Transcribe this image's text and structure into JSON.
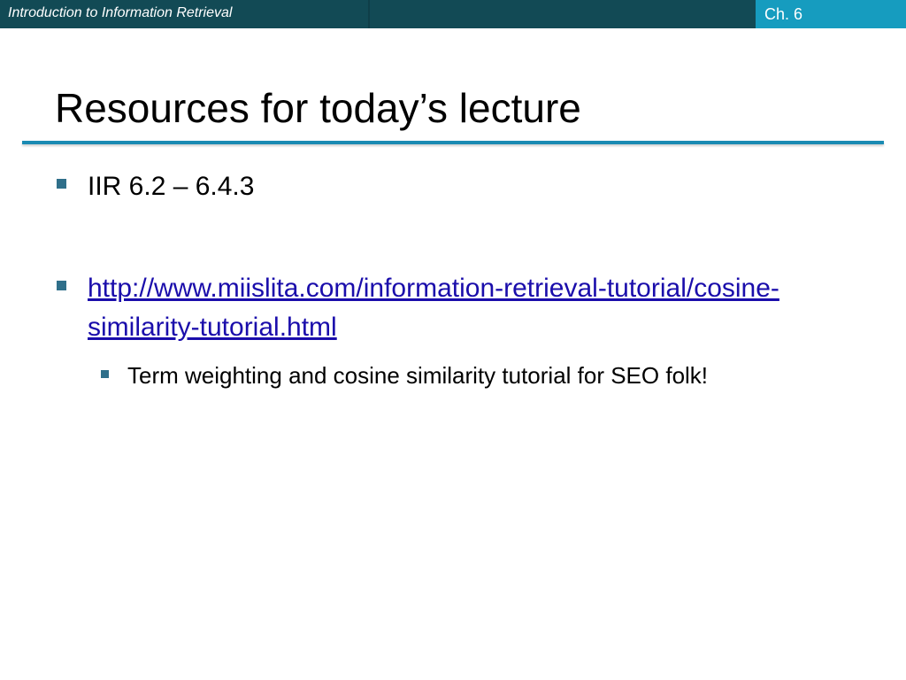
{
  "header": {
    "course_title": "Introduction to Information Retrieval",
    "chapter": "Ch. 6"
  },
  "slide": {
    "title": "Resources for today’s lecture",
    "bullets": [
      {
        "text": "IIR 6.2 – 6.4.3"
      },
      {
        "link_text": "http://www.miislita.com/information-retrieval-tutorial/cosine-similarity-tutorial.html",
        "sub_bullets": [
          {
            "text": "Term weighting and cosine similarity tutorial for SEO folk!"
          }
        ]
      }
    ]
  },
  "colors": {
    "header_background": "#124a55",
    "chapter_background": "#169cbf",
    "title_rule": "#1a8bb3",
    "bullet_marker": "#2f6f8a",
    "link": "#1a0dab"
  },
  "icons": {
    "bullet_marker": "square-bullet-icon"
  }
}
